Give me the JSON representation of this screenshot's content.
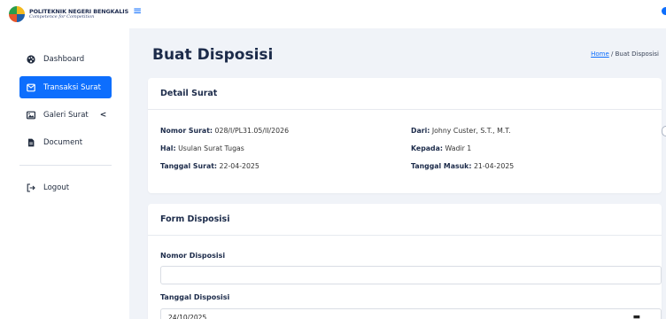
{
  "brand": {
    "name": "POLITEKNIK NEGERI BENGKALIS",
    "tagline": "Competence for Competition"
  },
  "sidebar": {
    "items": [
      {
        "label": "Dashboard",
        "icon": "palette-icon"
      },
      {
        "label": "Transaksi Surat",
        "icon": "envelope-icon",
        "active": true
      },
      {
        "label": "Galeri Surat",
        "icon": "images-icon",
        "has_submenu": true
      },
      {
        "label": "Document",
        "icon": "file-icon"
      },
      {
        "label": "Logout",
        "icon": "logout-icon"
      }
    ]
  },
  "page": {
    "title": "Buat Disposisi",
    "breadcrumb": {
      "home": "Home",
      "separator": "/",
      "current": "Buat Disposisi"
    }
  },
  "detail_card": {
    "title": "Detail Surat",
    "fields": {
      "nomor_surat": {
        "label": "Nomor Surat:",
        "value": "028/I/PL31.05/II/2026"
      },
      "dari": {
        "label": "Dari:",
        "value": "Johny Custer, S.T., M.T."
      },
      "hal": {
        "label": "Hal:",
        "value": "Usulan Surat Tugas"
      },
      "kepada": {
        "label": "Kepada:",
        "value": "Wadir 1"
      },
      "tanggal_surat": {
        "label": "Tanggal Surat:",
        "value": "22-04-2025"
      },
      "tanggal_masuk": {
        "label": "Tanggal Masuk:",
        "value": "21-04-2025"
      }
    }
  },
  "form_card": {
    "title": "Form Disposisi",
    "nomor_disposisi": {
      "label": "Nomor Disposisi",
      "value": ""
    },
    "tanggal_disposisi": {
      "label": "Tanggal Disposisi",
      "value": "24/10/2025"
    }
  },
  "colors": {
    "accent": "#0d6efd",
    "background": "#f0f3f8"
  }
}
